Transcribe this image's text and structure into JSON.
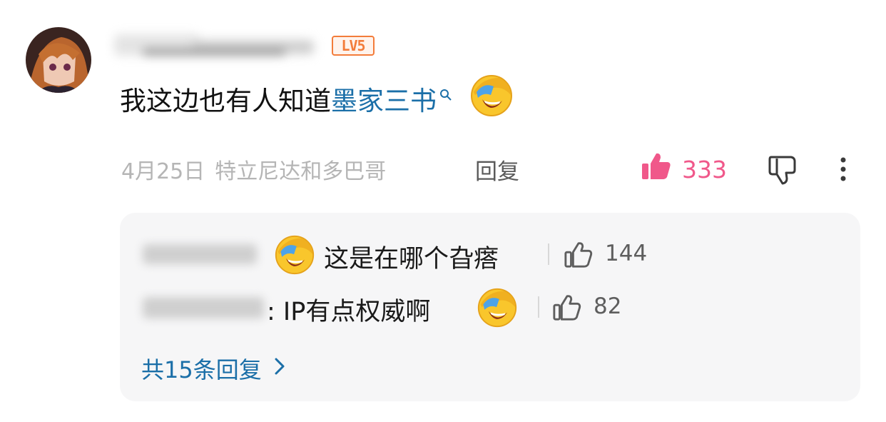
{
  "comment": {
    "level_badge": "LV5",
    "text_before_link": "我这边也有人知道",
    "link_text": "墨家三书",
    "date": "4月25日",
    "location": "特立尼达和多巴哥",
    "reply_label": "回复",
    "like_count": "333",
    "colors": {
      "link": "#1b6fa8",
      "like": "#f0588a",
      "badge": "#f37c3a"
    }
  },
  "replies": [
    {
      "text": "这是在哪个旮瘩",
      "like_count": "144"
    },
    {
      "text": ": IP有点权威啊",
      "like_count": "82"
    }
  ],
  "more_replies_label": "共15条回复",
  "icons": [
    "avatar",
    "level-badge",
    "search-icon",
    "laugh-cry-emoji-icon",
    "thumb-up-filled-icon",
    "thumb-down-icon",
    "more-vertical-icon",
    "thumb-up-outline-icon",
    "chevron-right-icon"
  ]
}
